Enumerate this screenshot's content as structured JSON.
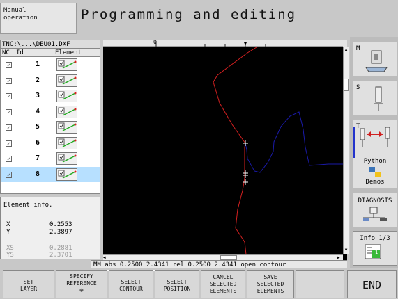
{
  "header": {
    "mode_label_line1": "Manual",
    "mode_label_line2": "operation",
    "title": "Programming and editing"
  },
  "tree": {
    "path": "TNC:\\...\\DEU01.DXF",
    "columns": [
      "NC",
      "Id",
      "Element"
    ],
    "rows": [
      {
        "id": "1",
        "checked": true
      },
      {
        "id": "2",
        "checked": true
      },
      {
        "id": "3",
        "checked": true
      },
      {
        "id": "4",
        "checked": true
      },
      {
        "id": "5",
        "checked": true
      },
      {
        "id": "6",
        "checked": true
      },
      {
        "id": "7",
        "checked": true
      },
      {
        "id": "8",
        "checked": true,
        "selected": true
      }
    ]
  },
  "element_info": {
    "title": "Element info.",
    "x_label": "X",
    "x_value": "0.2553",
    "y_label": "Y",
    "y_value": "2.3897",
    "xs_label": "XS",
    "xs_value": "0.2881",
    "ys_label": "YS",
    "ys_value": "2.3701"
  },
  "ruler": {
    "zero_label": "0"
  },
  "status_bar": "MM  abs 0.2500 2.4341 rel 0.2500 2.4341 open contour",
  "sidebar": {
    "m_label": "M",
    "s_label": "S",
    "t_label": "T",
    "python_line1": "Python",
    "python_line2": "Demos",
    "diagnosis_label": "DIAGNOSIS",
    "info_label": "Info 1/3",
    "info_badge": "1"
  },
  "softkeys": {
    "set_layer_1": "SET",
    "set_layer_2": "LAYER",
    "specify_ref_1": "SPECIFY",
    "specify_ref_2": "REFERENCE",
    "select_contour_1": "SELECT",
    "select_contour_2": "CONTOUR",
    "select_position_1": "SELECT",
    "select_position_2": "POSITION",
    "cancel_1": "CANCEL",
    "cancel_2": "SELECTED",
    "cancel_3": "ELEMENTS",
    "save_1": "SAVE",
    "save_2": "SELECTED",
    "save_3": "ELEMENTS",
    "end": "END"
  },
  "colors": {
    "contour_red": "#d42020",
    "contour_blue": "#1a1aa8",
    "selection_blue": "#b7e0ff",
    "canvas_bg": "#000000"
  }
}
